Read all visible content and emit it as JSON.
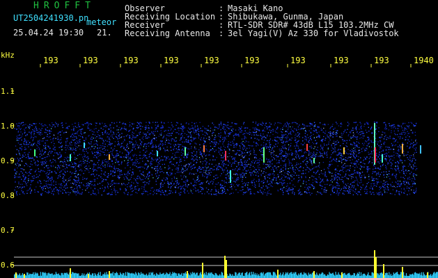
{
  "header": {
    "app_title": "HROFFT",
    "filename": "UT2504241930.pn",
    "mode_label": "meteor",
    "datetime": "25.04.24 19:30",
    "count": "21.",
    "meta": [
      {
        "label": "Observer",
        "value": "Masaki Kano"
      },
      {
        "label": "Receiving Location",
        "value": "Shibukawa, Gunma, Japan"
      },
      {
        "label": "Receiver",
        "value": "RTL-SDR SDR# 43dB L15 103.2MHz CW"
      },
      {
        "label": "Receiving Antenna",
        "value": "3el Yagi(V) Az 330 for Vladivostok"
      }
    ]
  },
  "axis": {
    "y_unit": "kHz",
    "y_ticks": [
      "1.1",
      "1.0",
      "0.9",
      "0.8",
      "0.7",
      "0.6"
    ],
    "x_ticks": [
      "193",
      "193",
      "193",
      "193",
      "193",
      "193",
      "193",
      "193",
      "193",
      "1940"
    ]
  },
  "colors": {
    "background": "#000000",
    "text_yellow": "#ffff40",
    "text_green": "#20c040",
    "text_cyan": "#3fe0ff",
    "noise_blue": "#1a2cc8",
    "bar_cyan": "#30d0ff",
    "bar_yellow": "#ffff30",
    "line_white": "#c8c8c8"
  }
}
